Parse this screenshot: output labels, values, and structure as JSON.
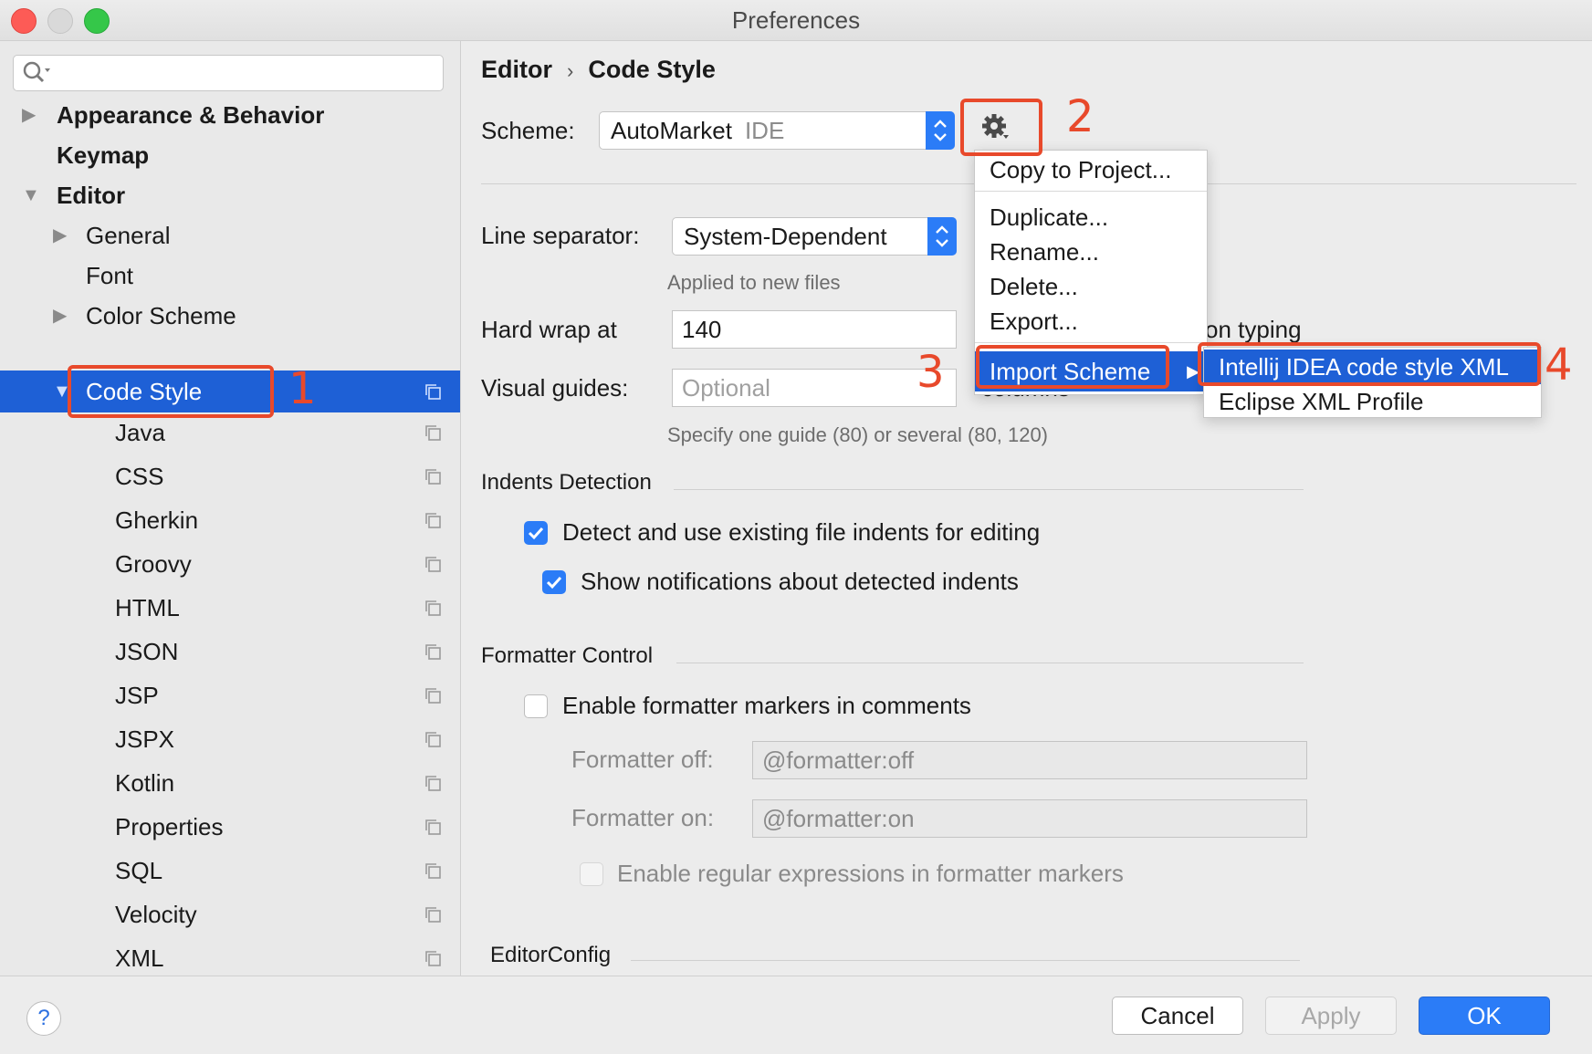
{
  "window": {
    "title": "Preferences"
  },
  "sidebar": {
    "search": {
      "value": "",
      "placeholder": ""
    },
    "items": [
      {
        "label": "Appearance & Behavior",
        "arrow": "▶"
      },
      {
        "label": "Keymap",
        "arrow": ""
      },
      {
        "label": "Editor",
        "arrow": "▼"
      },
      {
        "label": "General",
        "arrow": "▶"
      },
      {
        "label": "Font",
        "arrow": ""
      },
      {
        "label": "Color Scheme",
        "arrow": "▶"
      },
      {
        "label": "Code Style",
        "arrow": "▼"
      },
      {
        "label": "Java"
      },
      {
        "label": "CSS"
      },
      {
        "label": "Gherkin"
      },
      {
        "label": "Groovy"
      },
      {
        "label": "HTML"
      },
      {
        "label": "JSON"
      },
      {
        "label": "JSP"
      },
      {
        "label": "JSPX"
      },
      {
        "label": "Kotlin"
      },
      {
        "label": "Properties"
      },
      {
        "label": "SQL"
      },
      {
        "label": "Velocity"
      },
      {
        "label": "XML"
      }
    ]
  },
  "main": {
    "breadcrumb": {
      "parent": "Editor",
      "separator": "›",
      "current": "Code Style"
    },
    "scheme": {
      "label": "Scheme:",
      "name": "AutoMarket",
      "tag": "IDE"
    },
    "line_separator": {
      "label": "Line separator:",
      "value": "System-Dependent",
      "hint": "Applied to new files"
    },
    "hard_wrap": {
      "label": "Hard wrap at",
      "value": "140",
      "trailing_text": "on typing"
    },
    "visual_guides": {
      "label": "Visual guides:",
      "placeholder": "Optional",
      "trailing_text": "columns",
      "hint": "Specify one guide (80) or several (80, 120)"
    },
    "indents_detection": {
      "title": "Indents Detection",
      "detect": {
        "label": "Detect and use existing file indents for editing",
        "checked": true
      },
      "notify": {
        "label": "Show notifications about detected indents",
        "checked": true
      }
    },
    "formatter_control": {
      "title": "Formatter Control",
      "enable_markers": {
        "label": "Enable formatter markers in comments",
        "checked": false
      },
      "off": {
        "label": "Formatter off:",
        "value": "@formatter:off"
      },
      "on": {
        "label": "Formatter on:",
        "value": "@formatter:on"
      },
      "regex": {
        "label": "Enable regular expressions in formatter markers",
        "checked": false
      }
    },
    "editorconfig": {
      "title": "EditorConfig"
    }
  },
  "gear_menu": {
    "items": [
      "Copy to Project...",
      "Duplicate...",
      "Rename...",
      "Delete...",
      "Export...",
      "Import Scheme"
    ],
    "submenu_arrow": "▶"
  },
  "import_submenu": {
    "items": [
      "Intellij IDEA code style XML",
      "Eclipse XML Profile"
    ]
  },
  "annotations": {
    "n1": "1",
    "n2": "2",
    "n3": "3",
    "n4": "4"
  },
  "footer": {
    "help": "?",
    "cancel": "Cancel",
    "apply": "Apply",
    "ok": "OK"
  },
  "colors": {
    "accent": "#2b7cf7",
    "selection": "#1e60d6",
    "annotation": "#e8492b"
  },
  "icons": [
    "search-icon",
    "gear-icon",
    "copy-icon",
    "help-icon",
    "chevron-updown-icon"
  ]
}
